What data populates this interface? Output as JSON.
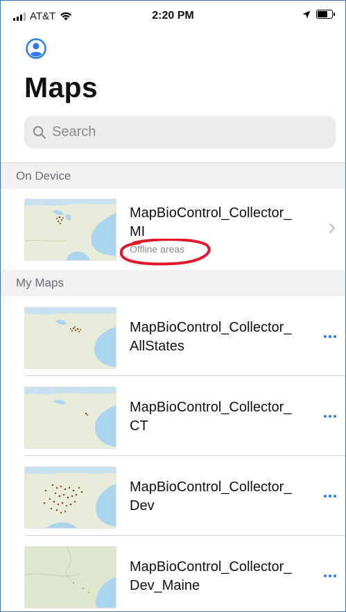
{
  "status_bar": {
    "carrier": "AT&T",
    "time": "2:20 PM",
    "icons": [
      "signal-icon",
      "wifi-icon",
      "location-arrow-icon",
      "battery-icon"
    ]
  },
  "header": {
    "account_icon": "person-circle-icon",
    "title": "Maps"
  },
  "search": {
    "placeholder": "Search",
    "icon": "search-icon"
  },
  "sections": {
    "on_device": {
      "label": "On Device",
      "items": [
        {
          "title_line1": "MapBioControl_Collector_",
          "title_line2": "MI",
          "subtitle": "Offline areas",
          "action_icon": "chevron-right-icon"
        }
      ]
    },
    "my_maps": {
      "label": "My Maps",
      "items": [
        {
          "title_line1": "MapBioControl_Collector_",
          "title_line2": "AllStates",
          "action_icon": "more-icon"
        },
        {
          "title_line1": "MapBioControl_Collector_",
          "title_line2": "CT",
          "action_icon": "more-icon"
        },
        {
          "title_line1": "MapBioControl_Collector_",
          "title_line2": "Dev",
          "action_icon": "more-icon"
        },
        {
          "title_line1": "MapBioControl_Collector_",
          "title_line2": "Dev_Maine",
          "action_icon": "more-icon"
        }
      ]
    }
  },
  "colors": {
    "accent": "#2b7de9",
    "annotation": "#e0182a",
    "section_bg": "#f1f1f3",
    "search_bg": "#ececee"
  }
}
